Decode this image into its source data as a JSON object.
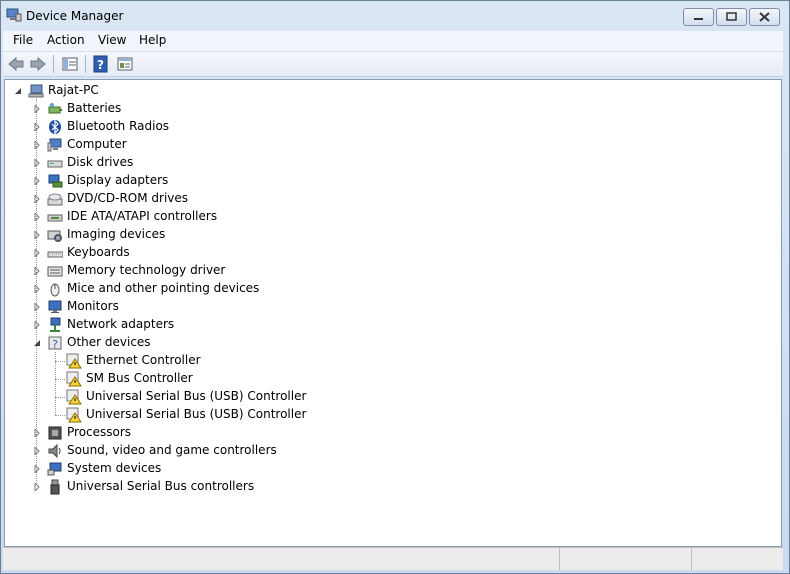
{
  "window": {
    "title": "Device Manager"
  },
  "menu": [
    "File",
    "Action",
    "View",
    "Help"
  ],
  "tree": {
    "root": "Rajat-PC",
    "categories": [
      {
        "label": "Batteries",
        "icon": "battery-icon"
      },
      {
        "label": "Bluetooth Radios",
        "icon": "bluetooth-icon"
      },
      {
        "label": "Computer",
        "icon": "computer-icon"
      },
      {
        "label": "Disk drives",
        "icon": "disk-drive-icon"
      },
      {
        "label": "Display adapters",
        "icon": "display-adapter-icon"
      },
      {
        "label": "DVD/CD-ROM drives",
        "icon": "dvd-drive-icon"
      },
      {
        "label": "IDE ATA/ATAPI controllers",
        "icon": "ide-controller-icon"
      },
      {
        "label": "Imaging devices",
        "icon": "camera-icon"
      },
      {
        "label": "Keyboards",
        "icon": "keyboard-icon"
      },
      {
        "label": "Memory technology driver",
        "icon": "memory-icon"
      },
      {
        "label": "Mice and other pointing devices",
        "icon": "mouse-icon"
      },
      {
        "label": "Monitors",
        "icon": "monitor-icon"
      },
      {
        "label": "Network adapters",
        "icon": "network-icon"
      },
      {
        "label": "Other devices",
        "icon": "unknown-device-icon",
        "expanded": true,
        "children": [
          {
            "label": "Ethernet Controller",
            "icon": "warning-device-icon"
          },
          {
            "label": "SM Bus Controller",
            "icon": "warning-device-icon"
          },
          {
            "label": "Universal Serial Bus (USB) Controller",
            "icon": "warning-device-icon"
          },
          {
            "label": "Universal Serial Bus (USB) Controller",
            "icon": "warning-device-icon"
          }
        ]
      },
      {
        "label": "Processors",
        "icon": "processor-icon"
      },
      {
        "label": "Sound, video and game controllers",
        "icon": "speaker-icon"
      },
      {
        "label": "System devices",
        "icon": "system-icon"
      },
      {
        "label": "Universal Serial Bus controllers",
        "icon": "usb-icon"
      }
    ]
  }
}
